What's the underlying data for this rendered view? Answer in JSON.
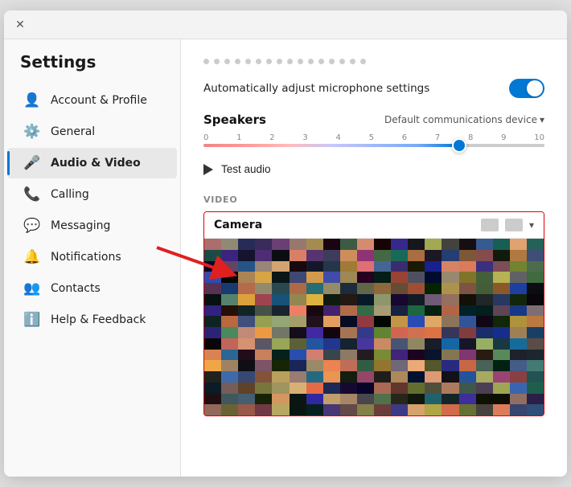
{
  "window": {
    "title": "Settings"
  },
  "sidebar": {
    "title": "Settings",
    "items": [
      {
        "id": "account-profile",
        "label": "Account & Profile",
        "icon": "👤",
        "active": false
      },
      {
        "id": "general",
        "label": "General",
        "icon": "⚙️",
        "active": false
      },
      {
        "id": "audio-video",
        "label": "Audio & Video",
        "icon": "🎤",
        "active": true
      },
      {
        "id": "calling",
        "label": "Calling",
        "icon": "📞",
        "active": false
      },
      {
        "id": "messaging",
        "label": "Messaging",
        "icon": "💬",
        "active": false
      },
      {
        "id": "notifications",
        "label": "Notifications",
        "icon": "🔔",
        "active": false
      },
      {
        "id": "contacts",
        "label": "Contacts",
        "icon": "👥",
        "active": false
      },
      {
        "id": "help-feedback",
        "label": "Help & Feedback",
        "icon": "ℹ️",
        "active": false
      }
    ]
  },
  "main": {
    "auto_mic_label": "Automatically adjust microphone settings",
    "speakers_label": "Speakers",
    "speakers_device": "Default communications device",
    "slider_ticks": [
      "0",
      "1",
      "2",
      "3",
      "4",
      "5",
      "6",
      "7",
      "8",
      "9",
      "10"
    ],
    "test_audio_label": "Test audio",
    "video_section_label": "VIDEO",
    "camera_label": "Camera"
  }
}
